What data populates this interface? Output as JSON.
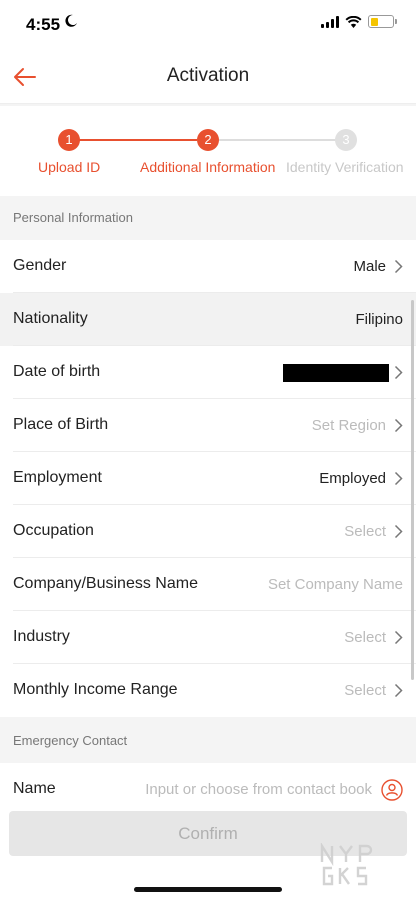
{
  "status_bar": {
    "time": "4:55",
    "battery_color": "#f5c400",
    "icons": [
      "moon-icon",
      "signal-icon",
      "wifi-icon",
      "battery-icon"
    ]
  },
  "header": {
    "title": "Activation",
    "back_icon": "arrow-left-icon"
  },
  "colors": {
    "accent": "#e8502f",
    "inactive": "#cccccc"
  },
  "stepper": {
    "steps": [
      {
        "number": "1",
        "label": "Upload ID",
        "state": "done"
      },
      {
        "number": "2",
        "label": "Additional Information",
        "state": "current"
      },
      {
        "number": "3",
        "label": "Identity Verification",
        "state": "pending"
      }
    ]
  },
  "sections": {
    "personal": "Personal Information",
    "emergency": "Emergency Contact"
  },
  "fields": [
    {
      "label": "Gender",
      "value": "Male",
      "placeholder": false
    },
    {
      "label": "Nationality",
      "value": "Filipino",
      "placeholder": false
    },
    {
      "label": "Date of birth",
      "value": "",
      "placeholder": false
    },
    {
      "label": "Place of Birth",
      "value": "Set Region",
      "placeholder": true
    },
    {
      "label": "Employment",
      "value": "Employed",
      "placeholder": false
    },
    {
      "label": "Occupation",
      "value": "Select",
      "placeholder": true
    },
    {
      "label": "Company/Business Name",
      "value": "Set Company Name",
      "placeholder": true
    },
    {
      "label": "Industry",
      "value": "Select",
      "placeholder": true
    },
    {
      "label": "Monthly Income Range",
      "value": "Select",
      "placeholder": true
    }
  ],
  "emergency": {
    "name_label": "Name",
    "name_placeholder": "Input or choose from contact book",
    "contact_icon": "contact-book-icon"
  },
  "confirm_label": "Confirm",
  "watermark": "NYP GKS"
}
